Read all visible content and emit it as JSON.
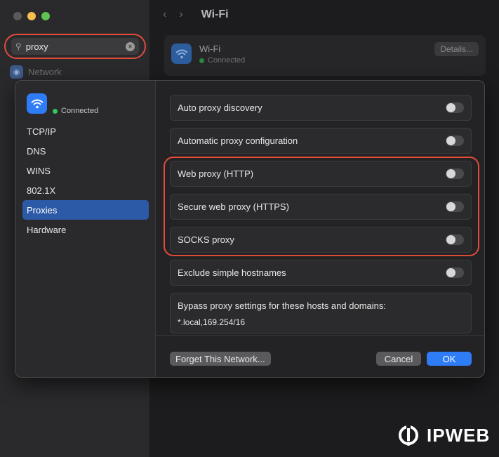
{
  "window": {
    "traffic_lights": [
      "close",
      "minimize",
      "maximize"
    ]
  },
  "search": {
    "value": "proxy",
    "icon": "search-icon",
    "clear_icon": "clear-icon"
  },
  "bg_sidebar": {
    "network_label": "Network"
  },
  "bg_main": {
    "title": "Wi-Fi",
    "card": {
      "name": "Wi-Fi",
      "status": "Connected",
      "details_label": "Details..."
    }
  },
  "sheet": {
    "status": "Connected",
    "nav": [
      {
        "label": "TCP/IP",
        "active": false
      },
      {
        "label": "DNS",
        "active": false
      },
      {
        "label": "WINS",
        "active": false
      },
      {
        "label": "802.1X",
        "active": false
      },
      {
        "label": "Proxies",
        "active": true
      },
      {
        "label": "Hardware",
        "active": false
      }
    ],
    "rows": [
      {
        "label": "Auto proxy discovery",
        "on": false
      },
      {
        "label": "Automatic proxy configuration",
        "on": false
      },
      {
        "label": "Web proxy (HTTP)",
        "on": false
      },
      {
        "label": "Secure web proxy (HTTPS)",
        "on": false
      },
      {
        "label": "SOCKS proxy",
        "on": false
      },
      {
        "label": "Exclude simple hostnames",
        "on": false
      }
    ],
    "bypass": {
      "label": "Bypass proxy settings for these hosts and domains:",
      "value": "*.local,169.254/16"
    },
    "buttons": {
      "forget": "Forget This Network...",
      "cancel": "Cancel",
      "ok": "OK"
    }
  },
  "watermark": {
    "text": "IPWEB"
  },
  "colors": {
    "accent": "#2f7df6",
    "highlight": "#e04b3a",
    "connected": "#34c759"
  }
}
